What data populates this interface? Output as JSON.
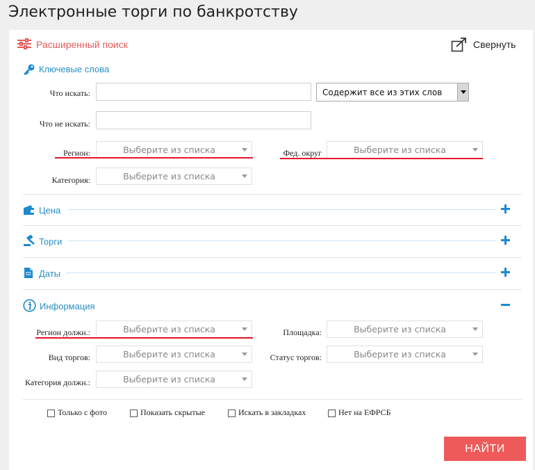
{
  "page": {
    "title": "Электронные торги по банкротству"
  },
  "header": {
    "search_label": "Расширенный поиск",
    "collapse_label": "Свернуть"
  },
  "keywords": {
    "title": "Ключевые слова",
    "what_label": "Что искать:",
    "what_value": "",
    "match_mode": "Содержит все из этих слов",
    "not_label": "Что не искать:",
    "not_value": "",
    "region_label": "Регион:",
    "region_value": "Выберите из списка",
    "district_label": "Фед. округ",
    "district_value": "Выберите из списка",
    "category_label": "Категория:",
    "category_value": "Выберите из списка"
  },
  "sections": {
    "price": "Цена",
    "auctions": "Торги",
    "dates": "Даты",
    "info": "Информация"
  },
  "info": {
    "debtor_region_label": "Регион должн.:",
    "debtor_region_value": "Выберите из списка",
    "platform_label": "Площадка:",
    "platform_value": "Выберите из списка",
    "auction_type_label": "Вид торгов:",
    "auction_type_value": "Выберите из списка",
    "auction_status_label": "Статус торгов:",
    "auction_status_value": "Выберите из списка",
    "debtor_category_label": "Категория должн.:",
    "debtor_category_value": "Выберите из списка"
  },
  "checkboxes": [
    {
      "label": "Только с фото",
      "checked": false
    },
    {
      "label": "Показать скрытые",
      "checked": false
    },
    {
      "label": "Искать в закладках",
      "checked": false
    },
    {
      "label": "Нет на ЕФРСБ",
      "checked": false
    }
  ],
  "submit_label": "НАЙТИ",
  "colors": {
    "accent_red": "#ee5a5a",
    "link_blue": "#2a90c4",
    "underline_red": "#e8102a"
  }
}
